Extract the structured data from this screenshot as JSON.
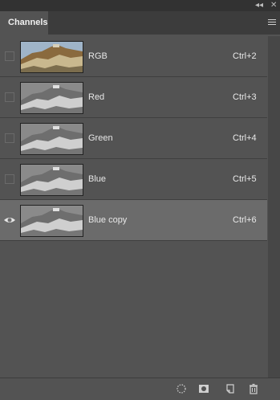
{
  "panel": {
    "tab_label": "Channels",
    "collapse_glyph": "◂◂",
    "close_glyph": "✕"
  },
  "channels": [
    {
      "name": "RGB",
      "shortcut": "Ctrl+2",
      "visible": false,
      "selected": false,
      "thumb": "color"
    },
    {
      "name": "Red",
      "shortcut": "Ctrl+3",
      "visible": false,
      "selected": false,
      "thumb": "gray"
    },
    {
      "name": "Green",
      "shortcut": "Ctrl+4",
      "visible": false,
      "selected": false,
      "thumb": "gray"
    },
    {
      "name": "Blue",
      "shortcut": "Ctrl+5",
      "visible": false,
      "selected": false,
      "thumb": "gray"
    },
    {
      "name": "Blue copy",
      "shortcut": "Ctrl+6",
      "visible": true,
      "selected": true,
      "thumb": "gray"
    }
  ],
  "footer_icons": [
    "load-channel-as-selection-icon",
    "save-selection-as-channel-icon",
    "new-channel-icon",
    "delete-channel-icon"
  ]
}
